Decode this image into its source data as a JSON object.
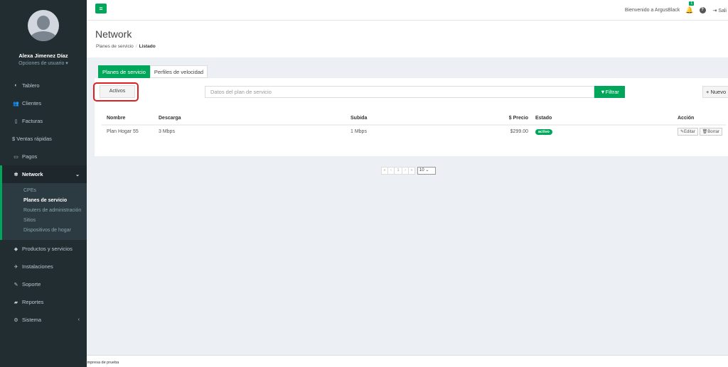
{
  "user": {
    "name": "Alexa Jimenez Díaz",
    "options": "Opciones de usuario ▾"
  },
  "menu": {
    "tablero": "Tablero",
    "clientes": "Clientes",
    "facturas": "Facturas",
    "ventas": "$ Ventas rápidas",
    "pagos": "Pagos",
    "network": "Network",
    "network_sub": [
      "CPEs",
      "Planes de servicio",
      "Routers de administración",
      "Sitios",
      "Dispositivos de hogar"
    ],
    "productos": "Productos y servicios",
    "instalaciones": "Instalaciones",
    "soporte": "Soporte",
    "reportes": "Reportes",
    "sistema": "Sistema"
  },
  "header": {
    "welcome": "Bienvenido a ArgusBlack",
    "notif_count": "1",
    "logout": "Sali"
  },
  "page": {
    "title": "Network",
    "crumb1": "Planes de servicio",
    "crumb2": "Listado"
  },
  "tabs": [
    "Planes de servicio",
    "Perfiles de velocidad"
  ],
  "filter": {
    "status_label": "Activos",
    "search_placeholder": "Datos del plan de servicio",
    "filter_label": "Filtrar",
    "new_label": "Nuevo"
  },
  "table": {
    "headers": [
      "Nombre",
      "Descarga",
      "Subida",
      "$ Precio",
      "Estado",
      "Acción"
    ],
    "rows": [
      {
        "nombre": "Plan Hogar 55",
        "descarga": "3 Mbps",
        "subida": "1 Mbps",
        "precio": "$299.00",
        "estado": "activo"
      }
    ],
    "edit_label": "Editar",
    "delete_label": "Borrar"
  },
  "pagination": {
    "first": "«",
    "prev": "‹",
    "page": "1",
    "next": "›",
    "last": "»",
    "page_size": "10"
  },
  "footer": "Empresa de prueba",
  "colors": {
    "accent": "#00a65a",
    "sidebar": "#222d32",
    "highlight": "#e02020"
  }
}
